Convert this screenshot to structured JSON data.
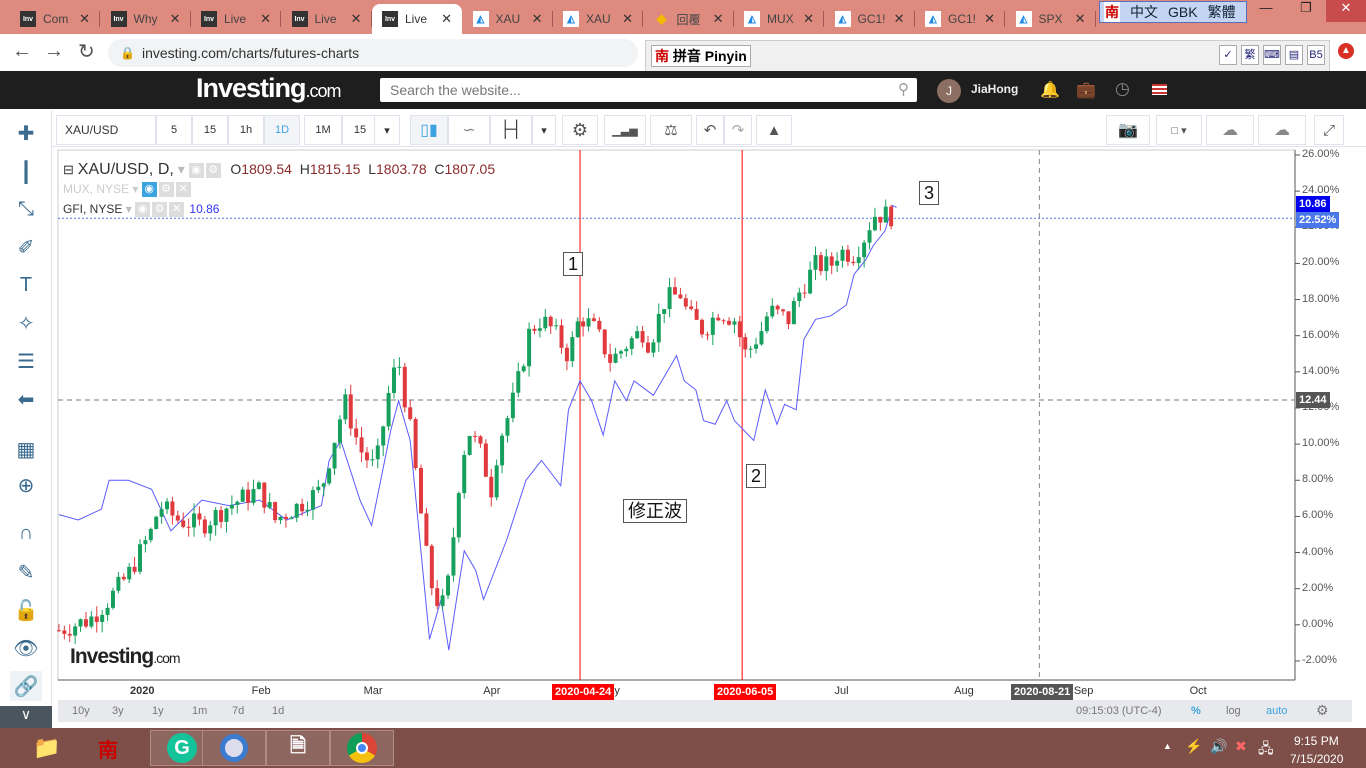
{
  "browser": {
    "tabs": [
      {
        "label": "Com",
        "icon": "investing"
      },
      {
        "label": "Why",
        "icon": "investing"
      },
      {
        "label": "Live",
        "icon": "investing"
      },
      {
        "label": "Live",
        "icon": "investing"
      },
      {
        "label": "Live",
        "icon": "investing",
        "active": true
      },
      {
        "label": "XAU",
        "icon": "tradingview"
      },
      {
        "label": "XAU",
        "icon": "tradingview"
      },
      {
        "label": "回覆",
        "icon": "gem"
      },
      {
        "label": "MUX",
        "icon": "tradingview"
      },
      {
        "label": "GC1!",
        "icon": "tradingview"
      },
      {
        "label": "GC1!",
        "icon": "tradingview"
      },
      {
        "label": "SPX",
        "icon": "tradingview"
      }
    ],
    "url": "investing.com/charts/futures-charts",
    "ime_bar": {
      "nan": "南",
      "lang": "中文",
      "enc": "GBK",
      "script": "繁體"
    },
    "pinyin_bar": {
      "label": "拼音 Pinyin",
      "trad": "繁",
      "b5": "B5"
    }
  },
  "site": {
    "logo": "Investing",
    "logo_suffix": ".com",
    "search_placeholder": "Search the website...",
    "user_initial": "J",
    "user_name": "JiaHong"
  },
  "toolbar": {
    "symbol": "XAU/USD",
    "intervals": [
      "5",
      "15",
      "1h",
      "1D",
      "1M",
      "15"
    ],
    "active_interval": "1D"
  },
  "legend": {
    "main": "XAU/USD, D,",
    "o_label": "O",
    "o": "1809.54",
    "h_label": "H",
    "h": "1815.15",
    "l_label": "L",
    "l": "1803.78",
    "c_label": "C",
    "c": "1807.05",
    "mux": "MUX, NYSE",
    "gfi": "GFI, NYSE",
    "gfi_value": "10.86"
  },
  "annotations": {
    "a1": "1",
    "a2": "2",
    "a3": "3",
    "correction": "修正波"
  },
  "watermark": "Investing.com",
  "price_tags": {
    "gfi": "10.86",
    "gold": "22.52%",
    "crosshair": "12.44"
  },
  "date_tags": {
    "d1": "2020-04-24",
    "d2": "2020-06-05",
    "d3": "2020-08-21"
  },
  "bottom": {
    "ranges": [
      "10y",
      "3y",
      "1y",
      "1m",
      "7d",
      "1d"
    ],
    "time": "09:15:03 (UTC-4)",
    "pct": "%",
    "log": "log",
    "auto": "auto"
  },
  "taskbar": {
    "time": "9:15 PM",
    "date": "7/15/2020"
  },
  "colors": {
    "up": "#17a05d",
    "down": "#e0393e",
    "gfi": "#5b5bff",
    "marker": "#ff0000"
  },
  "chart_data": {
    "type": "candlestick+line",
    "y_axis": {
      "unit": "%",
      "ylim": [
        -2,
        26
      ],
      "ticks": [
        "26.00%",
        "24.00%",
        "22.00%",
        "20.00%",
        "18.00%",
        "16.00%",
        "14.00%",
        "12.00%",
        "10.00%",
        "8.00%",
        "6.00%",
        "4.00%",
        "2.00%",
        "0.00%",
        "-2.00%"
      ]
    },
    "x_axis": {
      "origin": "2020-01-01",
      "ticks": [
        {
          "label": "2020",
          "day": 0
        },
        {
          "label": "Feb",
          "day": 31
        },
        {
          "label": "Mar",
          "day": 60
        },
        {
          "label": "Apr",
          "day": 91
        },
        {
          "label": "May",
          "day": 121
        },
        {
          "label": "Jul",
          "day": 182
        },
        {
          "label": "Aug",
          "day": 213
        },
        {
          "label": "Sep",
          "day": 244
        },
        {
          "label": "Oct",
          "day": 274
        }
      ]
    },
    "gold_close": {
      "day": [
        -21,
        -13,
        -8,
        -3,
        3,
        5,
        10,
        16,
        23,
        31,
        35,
        41,
        47,
        51,
        53,
        57,
        61,
        65,
        67,
        70,
        73,
        75,
        78,
        80,
        83,
        85,
        88,
        91,
        93,
        96,
        98,
        101,
        104,
        107,
        111,
        114,
        118,
        122,
        126,
        130,
        132,
        136,
        140,
        142,
        146,
        150,
        154,
        157,
        161,
        163,
        168,
        171,
        175,
        179,
        181,
        185,
        188,
        190,
        194,
        196
      ],
      "pct": [
        -0.3,
        0.3,
        1.4,
        2.8,
        5.2,
        6.6,
        5.8,
        5.5,
        6.6,
        7.5,
        5.8,
        6.6,
        7.5,
        10.8,
        12.4,
        9.7,
        8.6,
        13.5,
        14.6,
        10.8,
        5.8,
        2.5,
        0.8,
        2.5,
        8.6,
        10.8,
        9.7,
        7.5,
        10.2,
        11.9,
        13.5,
        16.3,
        16.9,
        16.3,
        14.9,
        17.1,
        16.3,
        14.6,
        15.5,
        16.3,
        15.5,
        18.0,
        18.3,
        17.1,
        16.3,
        17.4,
        16.9,
        14.9,
        16.3,
        17.4,
        16.9,
        18.5,
        19.9,
        19.9,
        20.7,
        20.5,
        21.6,
        22.7,
        22.7,
        22.5
      ]
    },
    "gfi_line": {
      "day": [
        -21,
        -16,
        -10,
        -8,
        -3,
        3,
        8,
        16,
        23,
        31,
        38,
        47,
        49,
        52,
        57,
        60,
        65,
        67,
        70,
        73,
        75,
        78,
        80,
        82,
        84,
        87,
        89,
        95,
        100,
        104,
        109,
        111,
        114,
        117,
        120,
        123,
        126,
        128,
        133,
        139,
        141,
        144,
        146,
        149,
        152,
        154,
        159,
        162,
        165,
        167,
        170,
        172,
        175,
        179,
        183,
        185,
        188,
        190,
        193,
        195,
        196
      ],
      "pct": [
        6.1,
        5.8,
        6.4,
        8.0,
        8.0,
        7.5,
        5.2,
        6.9,
        6.6,
        6.9,
        5.8,
        6.6,
        9.1,
        10.2,
        6.9,
        5.5,
        10.8,
        12.4,
        10.2,
        3.6,
        -0.8,
        1.4,
        -1.4,
        1.4,
        4.1,
        3.0,
        1.4,
        4.7,
        8.0,
        9.1,
        7.7,
        11.9,
        13.5,
        12.4,
        10.5,
        13.5,
        12.4,
        13.5,
        12.7,
        14.9,
        13.5,
        13.0,
        11.3,
        11.1,
        12.4,
        11.3,
        10.2,
        13.0,
        11.1,
        12.2,
        11.9,
        15.8,
        16.9,
        17.1,
        17.7,
        19.4,
        20.2,
        21.0,
        21.8,
        23.2,
        23.1
      ]
    },
    "markers": [
      {
        "type": "vertical",
        "date": "2020-04-24",
        "day": 114
      },
      {
        "type": "vertical",
        "date": "2020-06-05",
        "day": 156
      },
      {
        "type": "vertical-dashed",
        "date": "2020-08-21",
        "day": 233
      },
      {
        "type": "horizontal-dashed",
        "value": 12.44
      }
    ]
  }
}
